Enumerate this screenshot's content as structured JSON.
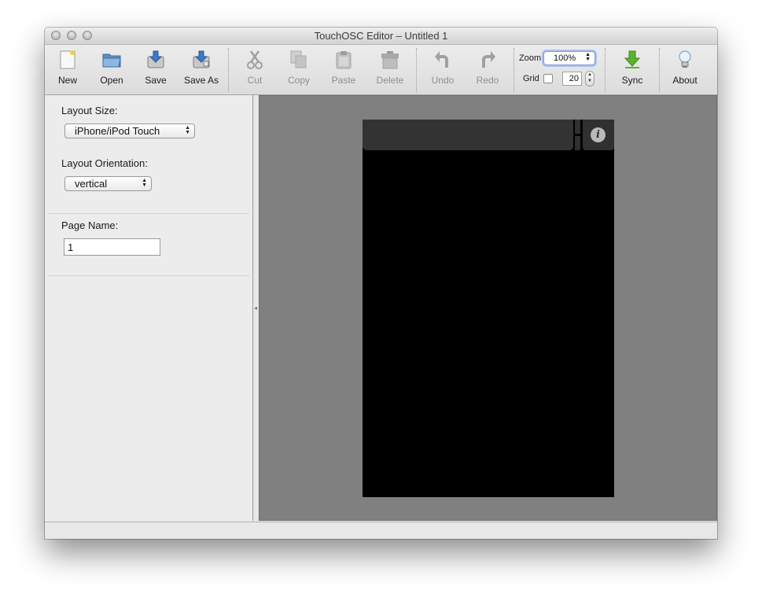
{
  "window": {
    "title": "TouchOSC Editor – Untitled 1"
  },
  "toolbar": {
    "new_label": "New",
    "open_label": "Open",
    "save_label": "Save",
    "saveas_label": "Save As",
    "cut_label": "Cut",
    "copy_label": "Copy",
    "paste_label": "Paste",
    "delete_label": "Delete",
    "undo_label": "Undo",
    "redo_label": "Redo",
    "zoom_label": "Zoom",
    "zoom_value": "100%",
    "grid_label": "Grid",
    "grid_size": "20",
    "sync_label": "Sync",
    "about_label": "About"
  },
  "sidebar": {
    "layout_size_label": "Layout Size:",
    "layout_size_value": "iPhone/iPod Touch",
    "layout_orientation_label": "Layout Orientation:",
    "layout_orientation_value": "vertical",
    "page_name_label": "Page Name:",
    "page_name_value": "1"
  },
  "canvas": {
    "info_glyph": "i",
    "colors": {
      "canvas_bg": "#808080",
      "device_bg": "#000000",
      "tab_bg": "#333333"
    }
  }
}
